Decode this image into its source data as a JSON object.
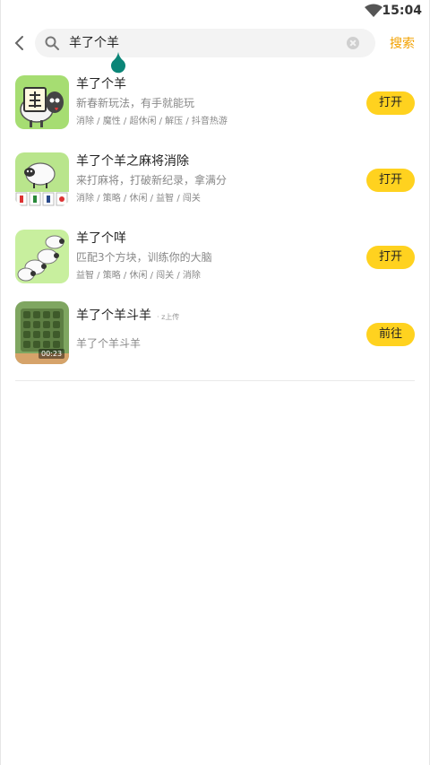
{
  "status": {
    "time": "15:04"
  },
  "search": {
    "query": "羊了个羊",
    "button": "搜索"
  },
  "results": [
    {
      "title": "羊了个羊",
      "subtitle": "新春新玩法，有手就能玩",
      "tags": "消除 / 魔性 / 超休闲 / 解压 / 抖音热游",
      "action": "打开"
    },
    {
      "title": "羊了个羊之麻将消除",
      "subtitle": "来打麻将，打破新纪录，拿满分",
      "tags": "消除 / 策略 / 休闲 / 益智 / 闯关",
      "action": "打开"
    },
    {
      "title": "羊了个咩",
      "subtitle": "匹配3个方块，训练你的大脑",
      "tags": "益智 / 策略 / 休闲 / 闯关 / 消除",
      "action": "打开"
    },
    {
      "title": "羊了个羊斗羊",
      "upload": "· z上传",
      "subtitle": "羊了个羊斗羊",
      "duration": "00:23",
      "action": "前往"
    }
  ],
  "colors": {
    "accent": "#ffd21f",
    "search_link": "#f2a100",
    "cursor_handle": "#0b8577"
  }
}
